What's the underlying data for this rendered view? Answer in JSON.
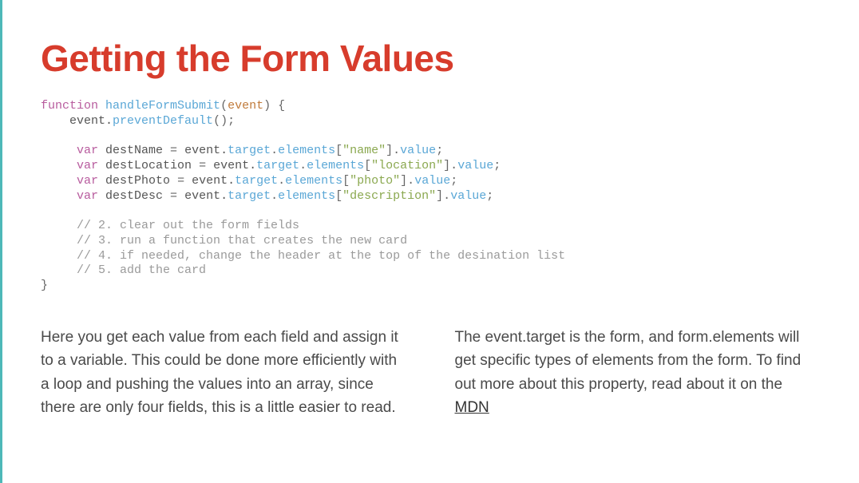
{
  "title": "Getting the Form Values",
  "code": {
    "l1_kw": "function",
    "l1_fn": "handleFormSubmit",
    "l1_open": "(",
    "l1_param": "event",
    "l1_close": ") {",
    "l2_indent": "    ",
    "l2_a": "event.",
    "l2_b": "preventDefault",
    "l2_c": "();",
    "l3_indent": "     ",
    "l3_kw": "var",
    "l3_a": " destName ",
    "l3_eq": "=",
    "l3_b": " event.",
    "l3_c": "target",
    "l3_d": ".",
    "l3_e": "elements",
    "l3_f": "[",
    "l3_str": "\"name\"",
    "l3_g": "].",
    "l3_h": "value",
    "l3_i": ";",
    "l4_kw": "var",
    "l4_a": " destLocation ",
    "l4_str": "\"location\"",
    "l5_kw": "var",
    "l5_a": " destPhoto ",
    "l5_str": "\"photo\"",
    "l6_kw": "var",
    "l6_a": " destDesc ",
    "l6_str": "\"description\"",
    "c1": "// 2. clear out the form fields",
    "c2": "// 3. run a function that creates the new card",
    "c3": "// 4. if needed, change the header at the top of the desination list",
    "c4": "// 5. add the card",
    "close": "}"
  },
  "paragraphs": {
    "left": "Here you get each value from each field and assign it to a variable. This could be done more efficiently with a loop and pushing the values into an array, since there are only four fields, this is a little easier to read.",
    "right_pre": "The event.target is the form, and form.elements will get specific types of elements from the form. To find out more about this property, read about it on the ",
    "right_link": "MDN"
  }
}
